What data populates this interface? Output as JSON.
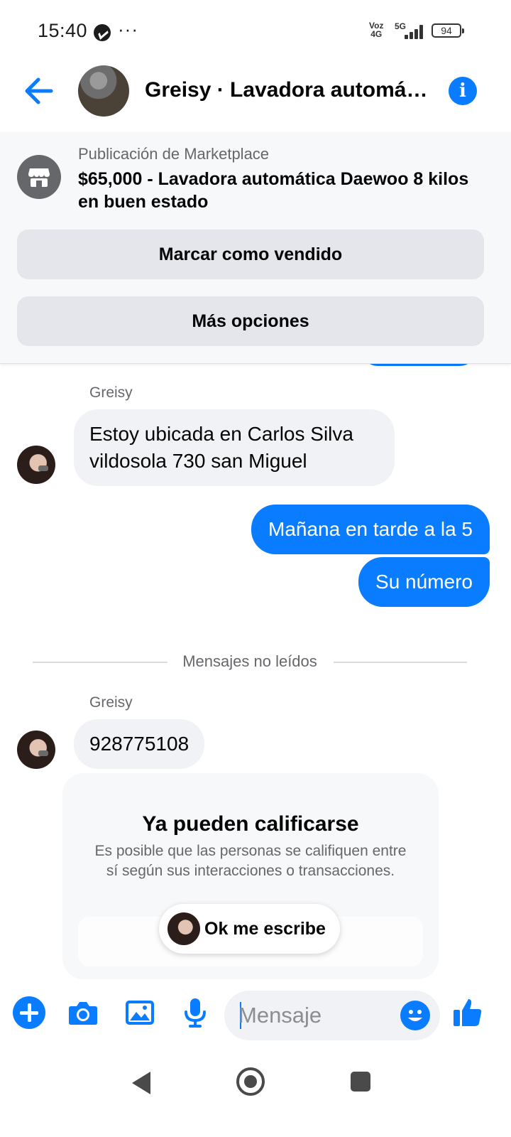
{
  "status_bar": {
    "time": "15:40",
    "voz": "Voz",
    "lte": "4G",
    "network": "5G",
    "battery": "94"
  },
  "header": {
    "title": "Greisy · Lavadora automáti..."
  },
  "marketplace": {
    "caption": "Publicación de Marketplace",
    "listing": "$65,000 - Lavadora automática Daewoo 8 kilos en buen estado",
    "mark_sold_label": "Marcar como vendido",
    "more_options_label": "Más opciones"
  },
  "messages": [
    {
      "sender": "Greisy",
      "text": "Estoy ubicada en Carlos Silva vildosola 730 san Miguel"
    },
    {
      "text": "Mañana en tarde a la 5"
    },
    {
      "text": "Su número"
    },
    {
      "sender": "Greisy",
      "text": "928775108"
    }
  ],
  "divider": {
    "label": "Mensajes no leídos"
  },
  "rating_card": {
    "title": "Ya pueden calificarse",
    "body": "Es posible que las personas se califiquen entre sí según sus interacciones o transacciones."
  },
  "reply_chip": {
    "text": "Ok me escribe"
  },
  "composer": {
    "placeholder": "Mensaje"
  },
  "colors": {
    "accent": "#0a7cff",
    "bubble_incoming": "#f0f2f5",
    "secondary_text": "#65676b"
  }
}
